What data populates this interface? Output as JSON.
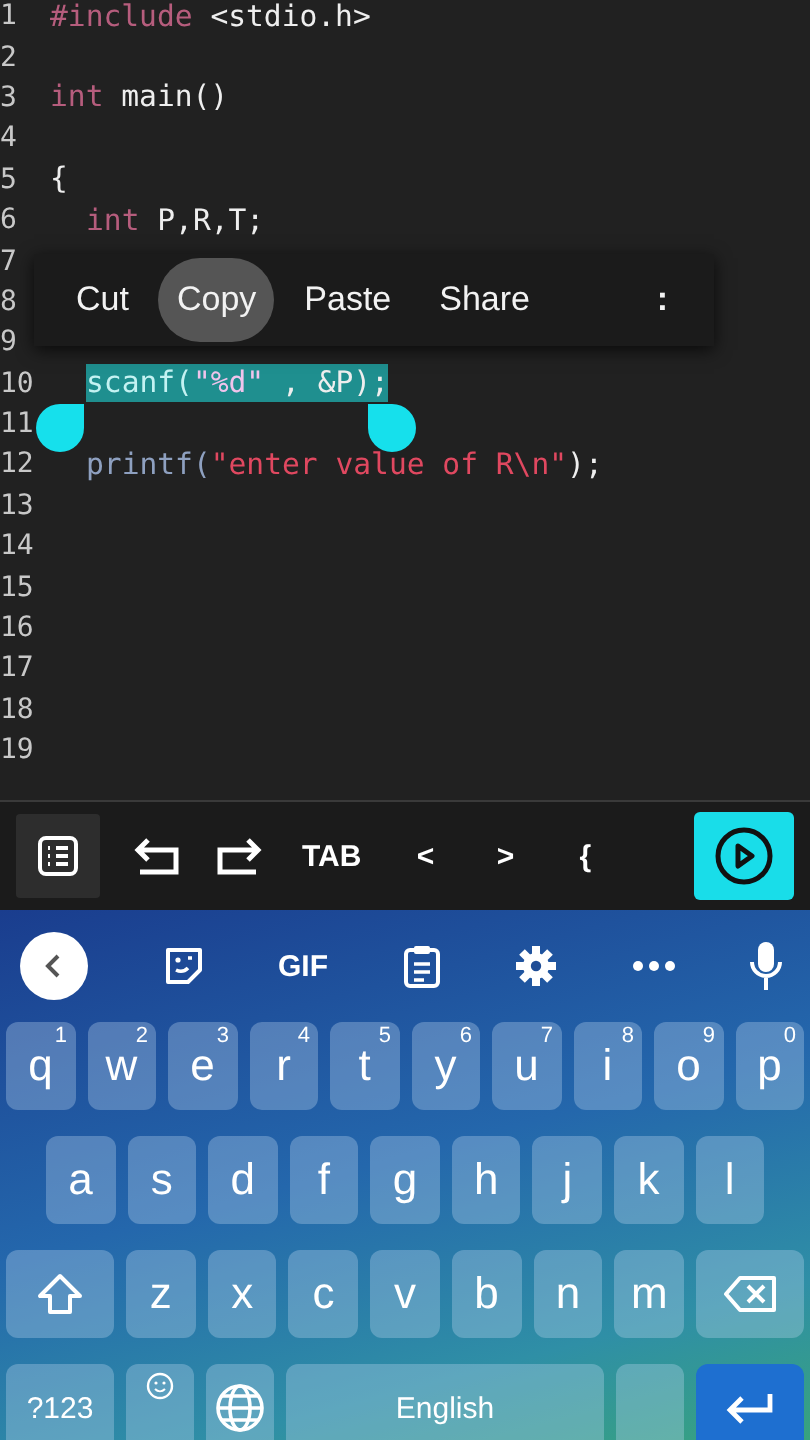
{
  "editor": {
    "lines": [
      {
        "number": "1",
        "tokens": [
          {
            "kind": "preprocessor",
            "text": "#include"
          },
          {
            "kind": "plain",
            "text": " <stdio.h>"
          }
        ]
      },
      {
        "number": "2"
      },
      {
        "number": "3",
        "tokens": [
          {
            "kind": "keyword",
            "text": "int"
          },
          {
            "kind": "plain",
            "text": " main()"
          }
        ]
      },
      {
        "number": "4"
      },
      {
        "number": "5",
        "tokens": [
          {
            "kind": "plain",
            "text": "{"
          }
        ]
      },
      {
        "number": "6",
        "indented": true,
        "tokens": [
          {
            "kind": "keyword",
            "text": "int"
          },
          {
            "kind": "plain",
            "text": " P,R,T;"
          }
        ]
      },
      {
        "number": "7"
      },
      {
        "number": "8"
      },
      {
        "number": "9"
      },
      {
        "number": "10",
        "indented": true,
        "selected": true,
        "tokens": [
          {
            "kind": "function",
            "text": "scanf("
          },
          {
            "kind": "string",
            "text": "\"%d\""
          },
          {
            "kind": "plain",
            "text": " , &P);"
          }
        ]
      },
      {
        "number": "11"
      },
      {
        "number": "12",
        "indented": true,
        "tokens": [
          {
            "kind": "function",
            "text": "printf("
          },
          {
            "kind": "string",
            "text": "\"enter value of R\\n\""
          },
          {
            "kind": "plain",
            "text": ");"
          }
        ]
      },
      {
        "number": "13"
      },
      {
        "number": "14"
      },
      {
        "number": "15"
      },
      {
        "number": "16"
      },
      {
        "number": "17"
      },
      {
        "number": "18"
      },
      {
        "number": "19"
      }
    ]
  },
  "context_menu": {
    "items": [
      {
        "label": "Cut",
        "pressed": false
      },
      {
        "label": "Copy",
        "pressed": true
      },
      {
        "label": "Paste",
        "pressed": false
      },
      {
        "label": "Share",
        "pressed": false
      }
    ],
    "more": ":"
  },
  "toolbar": {
    "items": [
      {
        "kind": "list"
      },
      {
        "kind": "undo"
      },
      {
        "kind": "redo"
      },
      {
        "kind": "text",
        "label": "TAB"
      },
      {
        "kind": "text",
        "label": "<"
      },
      {
        "kind": "text",
        "label": ">"
      },
      {
        "kind": "text",
        "label": "{"
      },
      {
        "kind": "run"
      }
    ]
  },
  "keyboard": {
    "suggestion_bar": [
      {
        "kind": "back"
      },
      {
        "kind": "sticker"
      },
      {
        "kind": "text",
        "label": "GIF"
      },
      {
        "kind": "clipboard"
      },
      {
        "kind": "settings"
      },
      {
        "kind": "more"
      },
      {
        "kind": "mic"
      }
    ],
    "rows": [
      {
        "keys": [
          {
            "kind": "letter",
            "label": "q",
            "hint": "1"
          },
          {
            "kind": "letter",
            "label": "w",
            "hint": "2"
          },
          {
            "kind": "letter",
            "label": "e",
            "hint": "3"
          },
          {
            "kind": "letter",
            "label": "r",
            "hint": "4"
          },
          {
            "kind": "letter",
            "label": "t",
            "hint": "5"
          },
          {
            "kind": "letter",
            "label": "y",
            "hint": "6"
          },
          {
            "kind": "letter",
            "label": "u",
            "hint": "7"
          },
          {
            "kind": "letter",
            "label": "i",
            "hint": "8"
          },
          {
            "kind": "letter",
            "label": "o",
            "hint": "9"
          },
          {
            "kind": "letter",
            "label": "p",
            "hint": "0"
          }
        ]
      },
      {
        "keys": [
          {
            "kind": "letter",
            "label": "a"
          },
          {
            "kind": "letter",
            "label": "s"
          },
          {
            "kind": "letter",
            "label": "d"
          },
          {
            "kind": "letter",
            "label": "f"
          },
          {
            "kind": "letter",
            "label": "g"
          },
          {
            "kind": "letter",
            "label": "h"
          },
          {
            "kind": "letter",
            "label": "j"
          },
          {
            "kind": "letter",
            "label": "k"
          },
          {
            "kind": "letter",
            "label": "l"
          }
        ]
      },
      {
        "keys": [
          {
            "kind": "shift"
          },
          {
            "kind": "letter",
            "label": "z"
          },
          {
            "kind": "letter",
            "label": "x"
          },
          {
            "kind": "letter",
            "label": "c"
          },
          {
            "kind": "letter",
            "label": "v"
          },
          {
            "kind": "letter",
            "label": "b"
          },
          {
            "kind": "letter",
            "label": "n"
          },
          {
            "kind": "letter",
            "label": "m"
          },
          {
            "kind": "backspace"
          }
        ]
      },
      {
        "keys": [
          {
            "kind": "symbols",
            "label": "?123"
          },
          {
            "kind": "emoji"
          },
          {
            "kind": "globe"
          },
          {
            "kind": "space",
            "label": "English"
          },
          {
            "kind": "period"
          },
          {
            "kind": "enter"
          }
        ]
      }
    ]
  }
}
